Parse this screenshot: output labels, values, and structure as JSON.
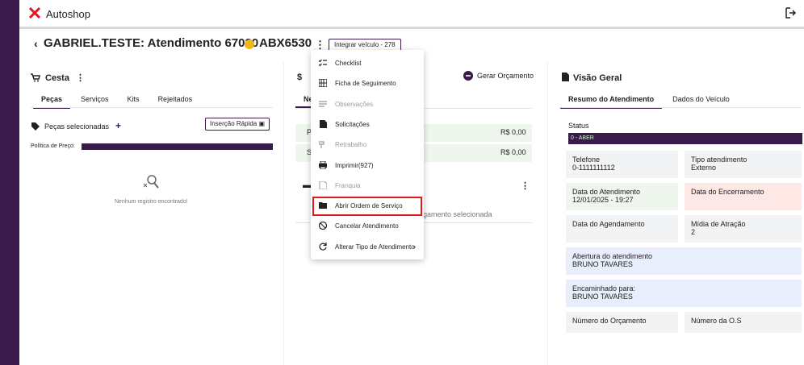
{
  "app": {
    "title": "Autoshop"
  },
  "header": {
    "title": "GABRIEL.TESTE: Atendimento 67020",
    "plate": "ABX6530",
    "integrar_label": "Integrar veículo - 278"
  },
  "cesta": {
    "title": "Cesta",
    "tabs": [
      "Peças",
      "Serviços",
      "Kits",
      "Rejeitados"
    ],
    "selected_label": "Peças selecionadas",
    "insercao_label": "Inserção Rápida",
    "policy_label": "Política de Preço:",
    "empty_text": "Nenhum registro encontrado!"
  },
  "orcamento": {
    "gerar_label": "Gerar Orçamento",
    "tab_partial": "Ne",
    "row1_letter": "P",
    "row2_letter": "S",
    "row1_value": "R$ 0,00",
    "row2_value": "R$ 0,00",
    "payment_text": "gamento selecionada"
  },
  "menu": {
    "items": [
      {
        "label": "Checklist",
        "icon": "checklist-icon",
        "disabled": false
      },
      {
        "label": "Ficha de Seguimento",
        "icon": "grid-icon",
        "disabled": false
      },
      {
        "label": "Observações",
        "icon": "lines-icon",
        "disabled": true
      },
      {
        "label": "Solicitações",
        "icon": "document-icon",
        "disabled": false
      },
      {
        "label": "Retrabalho",
        "icon": "hammer-icon",
        "disabled": true
      },
      {
        "label": "Imprimir(927)",
        "icon": "print-icon",
        "disabled": false
      },
      {
        "label": "Franquia",
        "icon": "doc-icon",
        "disabled": true
      },
      {
        "label": "Abrir Ordem de Serviço",
        "icon": "folder-icon",
        "disabled": false
      },
      {
        "label": "Cancelar Atendimento",
        "icon": "cancel-icon",
        "disabled": false
      },
      {
        "label": "Alterar Tipo de Atendimento",
        "icon": "refresh-icon",
        "disabled": false
      }
    ]
  },
  "visao": {
    "title": "Visão Geral",
    "tabs": [
      "Resumo do Atendimento",
      "Dados do Veículo"
    ],
    "status_label": "Status",
    "status_value": "0 - ABER",
    "telefone_label": "Telefone",
    "telefone_value": "0-1111111112",
    "tipo_label": "Tipo atendimento",
    "tipo_value": "Externo",
    "data_atend_label": "Data do Atendimento",
    "data_atend_value": "12/01/2025 - 19:27",
    "data_encerr_label": "Data do Encerramento",
    "data_agend_label": "Data do Agendamento",
    "midia_label": "Mídia de Atração",
    "midia_value": "2",
    "abertura_label": "Abertura do atendimento",
    "abertura_value": "BRUNO TAVARES",
    "encaminhado_label": "Encaminhado para:",
    "encaminhado_value": "BRUNO TAVARES",
    "num_orc_label": "Número do Orçamento",
    "num_os_label": "Número da O.S"
  },
  "colors": {
    "brand": "#3a1a4a",
    "accent_red": "#e0181e",
    "warn_yellow": "#f2b51a"
  }
}
